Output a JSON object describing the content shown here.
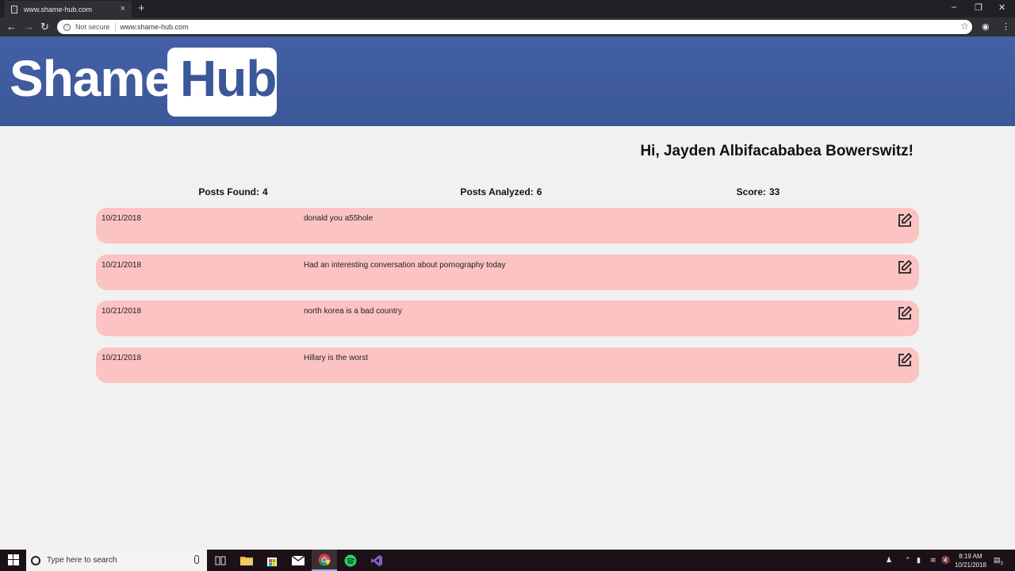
{
  "browser": {
    "tab_title": "www.shame-hub.com",
    "tab_close": "×",
    "new_tab": "+",
    "security_label": "Not secure",
    "url": "www.shame-hub.com",
    "window_controls": {
      "minimize": "–",
      "restore": "❐",
      "close": "✕"
    }
  },
  "site": {
    "logo_left": "Shame",
    "logo_right": "Hub",
    "brand_color": "#3a5797"
  },
  "greeting": "Hi, Jayden Albifacababea Bowerswitz!",
  "stats": {
    "posts_found_label": "Posts Found:",
    "posts_found_value": "4",
    "posts_analyzed_label": "Posts Analyzed:",
    "posts_analyzed_value": "6",
    "score_label": "Score:",
    "score_value": "33"
  },
  "posts": [
    {
      "date": "10/21/2018",
      "text": "donald you a55hole"
    },
    {
      "date": "10/21/2018",
      "text": "Had an interesting conversation about pornography today"
    },
    {
      "date": "10/21/2018",
      "text": "north korea is a bad country"
    },
    {
      "date": "10/21/2018",
      "text": "Hillary is the worst"
    }
  ],
  "post_color": "#fcc3c3",
  "taskbar": {
    "search_placeholder": "Type here to search",
    "time": "8:19 AM",
    "date": "10/21/2018",
    "notification_count": "3"
  }
}
